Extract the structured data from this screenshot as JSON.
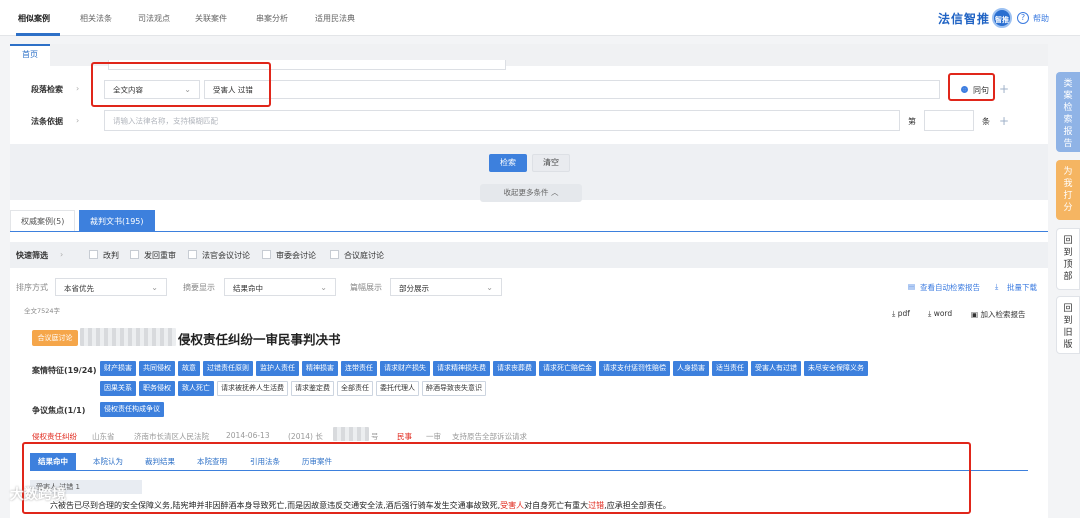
{
  "nav": {
    "tabs": [
      "相似案例",
      "相关法条",
      "司法观点",
      "关联案件",
      "串案分析",
      "适用民法典"
    ],
    "active": "相似案例",
    "brand": "法信智推",
    "brand_badge": "智推",
    "help_label": "帮助"
  },
  "page_tab": "首页",
  "search": {
    "paragraph_label": "段落检索",
    "scope_select": "全文内容",
    "keyword_value": "受害人 过错",
    "option_label": "同句",
    "law_label": "法条依据",
    "law_placeholder": "请输入法律名称，支持模糊匹配",
    "article_prefix": "第",
    "article_suffix": "条",
    "search_button": "检索",
    "clear_button": "清空",
    "collapse_label": "收起更多条件"
  },
  "result_tabs": [
    {
      "label": "权威案例(5)",
      "active": false
    },
    {
      "label": "裁判文书(195)",
      "active": true
    }
  ],
  "quick_filter": {
    "label": "快速筛选",
    "options": [
      "改判",
      "发回重审",
      "法官会议讨论",
      "审委会讨论",
      "合议庭讨论"
    ]
  },
  "sort": {
    "label": "排序方式",
    "value": "本省优先",
    "summary_label": "摘要显示",
    "summary_value": "结果命中",
    "paragraph_label": "篇幅展示",
    "paragraph_value": "部分展示",
    "report_link": "查看自动检索报告",
    "batch_link": "批量下载"
  },
  "result": {
    "word_count": "全文7524字",
    "tag": "合议庭讨论",
    "title_visible": "侵权责任纠纷一审民事判决书",
    "actions": [
      "pdf",
      "word",
      "加入检索报告"
    ],
    "features_label": "案情特征(19/24)",
    "features": [
      {
        "label": "财产损害",
        "on": true
      },
      {
        "label": "共同侵权",
        "on": true
      },
      {
        "label": "故意",
        "on": true
      },
      {
        "label": "过错责任原则",
        "on": true
      },
      {
        "label": "监护人责任",
        "on": true
      },
      {
        "label": "精神损害",
        "on": true
      },
      {
        "label": "连带责任",
        "on": true
      },
      {
        "label": "请求财产损失",
        "on": true
      },
      {
        "label": "请求精神损失费",
        "on": true
      },
      {
        "label": "请求丧葬费",
        "on": true
      },
      {
        "label": "请求死亡赔偿金",
        "on": true
      },
      {
        "label": "请求支付惩罚性赔偿",
        "on": true
      },
      {
        "label": "人身损害",
        "on": true
      },
      {
        "label": "适当责任",
        "on": true
      },
      {
        "label": "受害人有过错",
        "on": true
      },
      {
        "label": "未尽安全保障义务",
        "on": true
      },
      {
        "label": "因果关系",
        "on": true
      },
      {
        "label": "职务侵权",
        "on": true
      },
      {
        "label": "致人死亡",
        "on": true
      },
      {
        "label": "请求被抚养人生活费",
        "on": false
      },
      {
        "label": "请求鉴定费",
        "on": false
      },
      {
        "label": "全部责任",
        "on": false
      },
      {
        "label": "委托代理人",
        "on": false
      },
      {
        "label": "醉酒导致丧失意识",
        "on": false
      }
    ],
    "focus_label": "争议焦点(1/1)",
    "focus": [
      "侵权责任构成争议"
    ],
    "meta": {
      "cause": "侵权责任纠纷",
      "province": "山东省",
      "court": "济南市长清区人民法院",
      "date": "2014-06-13",
      "case_no_a": "(2014) 长",
      "case_no_b": "号",
      "type": "民事",
      "level": "一审",
      "outcome": "支持原告全部诉讼请求"
    },
    "detail_tabs": [
      "结果命中",
      "本院认为",
      "裁判结果",
      "本院查明",
      "引用法条",
      "历审案件"
    ],
    "excerpt_box": "受害人 过错 1",
    "excerpt_a": "六被告已尽到合理的安全保障义务,陆宪坤并非因醉酒本身导致死亡,而是因故意违反交通安全法,酒后强行骑车发生交通事故致死,",
    "excerpt_hl1": "受害人",
    "excerpt_b": "对自身死亡有重大",
    "excerpt_hl2": "过错",
    "excerpt_c": ",应承担全部责任。"
  },
  "sidebar": [
    "类案检索报告",
    "为我打分",
    "回到顶部",
    "回到旧版"
  ],
  "watermark": "大数跨境"
}
